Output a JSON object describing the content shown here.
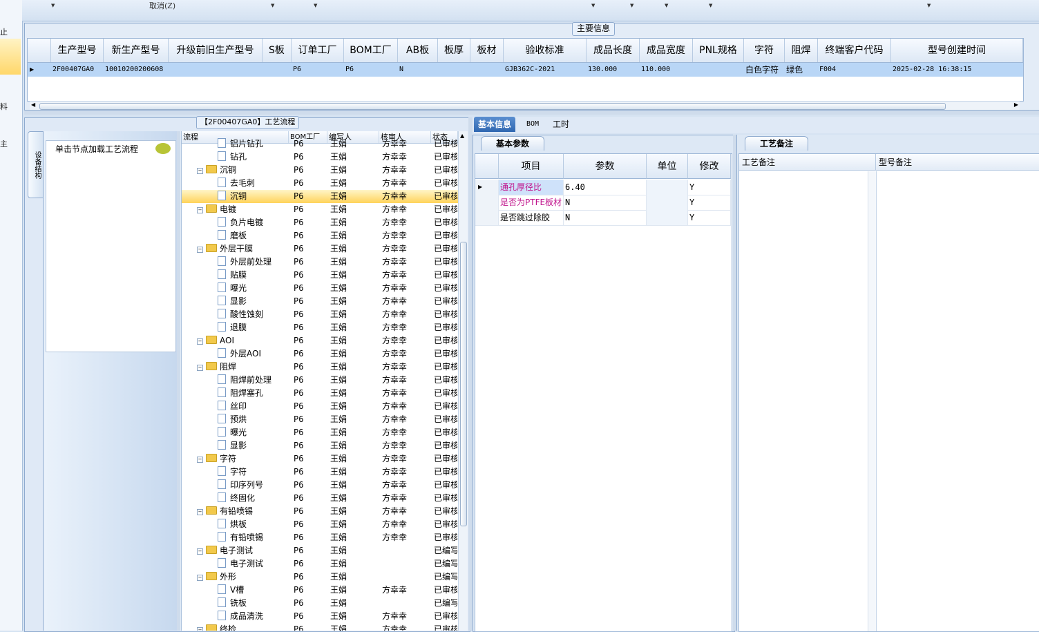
{
  "toolbar": {
    "cancel_label": "取消(Z)"
  },
  "left_nav": {
    "glyphs": [
      "止",
      "料",
      "主"
    ]
  },
  "main_info": {
    "title": "主要信息",
    "columns": [
      "生产型号",
      "新生产型号",
      "升级前旧生产型号",
      "S板",
      "订单工厂",
      "BOM工厂",
      "AB板",
      "板厚",
      "板材",
      "验收标准",
      "成品长度",
      "成品宽度",
      "PNL规格",
      "字符",
      "阻焊",
      "终端客户代码",
      "型号创建时间"
    ],
    "row": [
      "2F00407GA0",
      "10010200200608",
      "",
      "",
      "P6",
      "P6",
      "N",
      "",
      "",
      "GJB362C-2021",
      "130.000",
      "110.000",
      "",
      "白色字符",
      "绿色",
      "F004",
      "2025-02-28 16:38:15"
    ]
  },
  "flow": {
    "title": "【2F00407GA0】工艺流程",
    "side_tab": "设备结构",
    "node_hint": "单击节点加载工艺流程",
    "columns": [
      "流程",
      "BOM工厂",
      "编写人",
      "核审人",
      "状态"
    ],
    "rows": [
      {
        "level": 1,
        "name": "铝片钻孔",
        "bom": "P6",
        "writer": "王娟",
        "reviewer": "方幸幸",
        "status": "已审核"
      },
      {
        "level": 1,
        "name": "钻孔",
        "bom": "P6",
        "writer": "王娟",
        "reviewer": "方幸幸",
        "status": "已审核"
      },
      {
        "level": 0,
        "name": "沉铜",
        "bom": "P6",
        "writer": "王娟",
        "reviewer": "方幸幸",
        "status": "已审核"
      },
      {
        "level": 1,
        "name": "去毛刺",
        "bom": "P6",
        "writer": "王娟",
        "reviewer": "方幸幸",
        "status": "已审核"
      },
      {
        "level": 1,
        "name": "沉铜",
        "bom": "P6",
        "writer": "王娟",
        "reviewer": "方幸幸",
        "status": "已审核",
        "selected": true
      },
      {
        "level": 0,
        "name": "电镀",
        "bom": "P6",
        "writer": "王娟",
        "reviewer": "方幸幸",
        "status": "已审核"
      },
      {
        "level": 1,
        "name": "负片电镀",
        "bom": "P6",
        "writer": "王娟",
        "reviewer": "方幸幸",
        "status": "已审核"
      },
      {
        "level": 1,
        "name": "磨板",
        "bom": "P6",
        "writer": "王娟",
        "reviewer": "方幸幸",
        "status": "已审核"
      },
      {
        "level": 0,
        "name": "外层干膜",
        "bom": "P6",
        "writer": "王娟",
        "reviewer": "方幸幸",
        "status": "已审核"
      },
      {
        "level": 1,
        "name": "外层前处理",
        "bom": "P6",
        "writer": "王娟",
        "reviewer": "方幸幸",
        "status": "已审核"
      },
      {
        "level": 1,
        "name": "贴膜",
        "bom": "P6",
        "writer": "王娟",
        "reviewer": "方幸幸",
        "status": "已审核"
      },
      {
        "level": 1,
        "name": "曝光",
        "bom": "P6",
        "writer": "王娟",
        "reviewer": "方幸幸",
        "status": "已审核"
      },
      {
        "level": 1,
        "name": "显影",
        "bom": "P6",
        "writer": "王娟",
        "reviewer": "方幸幸",
        "status": "已审核"
      },
      {
        "level": 1,
        "name": "酸性蚀刻",
        "bom": "P6",
        "writer": "王娟",
        "reviewer": "方幸幸",
        "status": "已审核"
      },
      {
        "level": 1,
        "name": "退膜",
        "bom": "P6",
        "writer": "王娟",
        "reviewer": "方幸幸",
        "status": "已审核"
      },
      {
        "level": 0,
        "name": "AOI",
        "bom": "P6",
        "writer": "王娟",
        "reviewer": "方幸幸",
        "status": "已审核"
      },
      {
        "level": 1,
        "name": "外层AOI",
        "bom": "P6",
        "writer": "王娟",
        "reviewer": "方幸幸",
        "status": "已审核"
      },
      {
        "level": 0,
        "name": "阻焊",
        "bom": "P6",
        "writer": "王娟",
        "reviewer": "方幸幸",
        "status": "已审核"
      },
      {
        "level": 1,
        "name": "阻焊前处理",
        "bom": "P6",
        "writer": "王娟",
        "reviewer": "方幸幸",
        "status": "已审核"
      },
      {
        "level": 1,
        "name": "阻焊塞孔",
        "bom": "P6",
        "writer": "王娟",
        "reviewer": "方幸幸",
        "status": "已审核"
      },
      {
        "level": 1,
        "name": "丝印",
        "bom": "P6",
        "writer": "王娟",
        "reviewer": "方幸幸",
        "status": "已审核"
      },
      {
        "level": 1,
        "name": "预烘",
        "bom": "P6",
        "writer": "王娟",
        "reviewer": "方幸幸",
        "status": "已审核"
      },
      {
        "level": 1,
        "name": "曝光",
        "bom": "P6",
        "writer": "王娟",
        "reviewer": "方幸幸",
        "status": "已审核"
      },
      {
        "level": 1,
        "name": "显影",
        "bom": "P6",
        "writer": "王娟",
        "reviewer": "方幸幸",
        "status": "已审核"
      },
      {
        "level": 0,
        "name": "字符",
        "bom": "P6",
        "writer": "王娟",
        "reviewer": "方幸幸",
        "status": "已审核"
      },
      {
        "level": 1,
        "name": "字符",
        "bom": "P6",
        "writer": "王娟",
        "reviewer": "方幸幸",
        "status": "已审核"
      },
      {
        "level": 1,
        "name": "印序列号",
        "bom": "P6",
        "writer": "王娟",
        "reviewer": "方幸幸",
        "status": "已审核"
      },
      {
        "level": 1,
        "name": "终固化",
        "bom": "P6",
        "writer": "王娟",
        "reviewer": "方幸幸",
        "status": "已审核"
      },
      {
        "level": 0,
        "name": "有铅喷锡",
        "bom": "P6",
        "writer": "王娟",
        "reviewer": "方幸幸",
        "status": "已审核"
      },
      {
        "level": 1,
        "name": "烘板",
        "bom": "P6",
        "writer": "王娟",
        "reviewer": "方幸幸",
        "status": "已审核"
      },
      {
        "level": 1,
        "name": "有铅喷锡",
        "bom": "P6",
        "writer": "王娟",
        "reviewer": "方幸幸",
        "status": "已审核"
      },
      {
        "level": 0,
        "name": "电子测试",
        "bom": "P6",
        "writer": "王娟",
        "reviewer": "",
        "status": "已编写"
      },
      {
        "level": 1,
        "name": "电子测试",
        "bom": "P6",
        "writer": "王娟",
        "reviewer": "",
        "status": "已编写"
      },
      {
        "level": 0,
        "name": "外形",
        "bom": "P6",
        "writer": "王娟",
        "reviewer": "",
        "status": "已编写"
      },
      {
        "level": 1,
        "name": "V槽",
        "bom": "P6",
        "writer": "王娟",
        "reviewer": "方幸幸",
        "status": "已审核"
      },
      {
        "level": 1,
        "name": "铣板",
        "bom": "P6",
        "writer": "王娟",
        "reviewer": "",
        "status": "已编写"
      },
      {
        "level": 1,
        "name": "成品清洗",
        "bom": "P6",
        "writer": "王娟",
        "reviewer": "方幸幸",
        "status": "已审核"
      },
      {
        "level": 0,
        "name": "终检",
        "bom": "P6",
        "writer": "王娟",
        "reviewer": "方幸幸",
        "status": "已审核"
      }
    ]
  },
  "tabs": [
    "基本信息",
    "BOM",
    "工时"
  ],
  "basic": {
    "title": "基本参数",
    "columns": [
      "项目",
      "参数",
      "单位",
      "修改"
    ],
    "rows": [
      {
        "item": "通孔厚径比",
        "param": "6.40",
        "unit": "",
        "edit": "Y"
      },
      {
        "item": "是否为PTFE板材",
        "param": "N",
        "unit": "",
        "edit": "Y"
      },
      {
        "item": "是否跳过除胶",
        "param": "N",
        "unit": "",
        "edit": "Y"
      }
    ]
  },
  "notes": {
    "title": "工艺备注",
    "columns": [
      "工艺备注",
      "型号备注"
    ]
  },
  "colors": {
    "accent_tab": "#2f67b1",
    "selected_row": "#ffd35a",
    "grid_selected": "#b9d6f6",
    "magenta_item": "#c0148c"
  }
}
